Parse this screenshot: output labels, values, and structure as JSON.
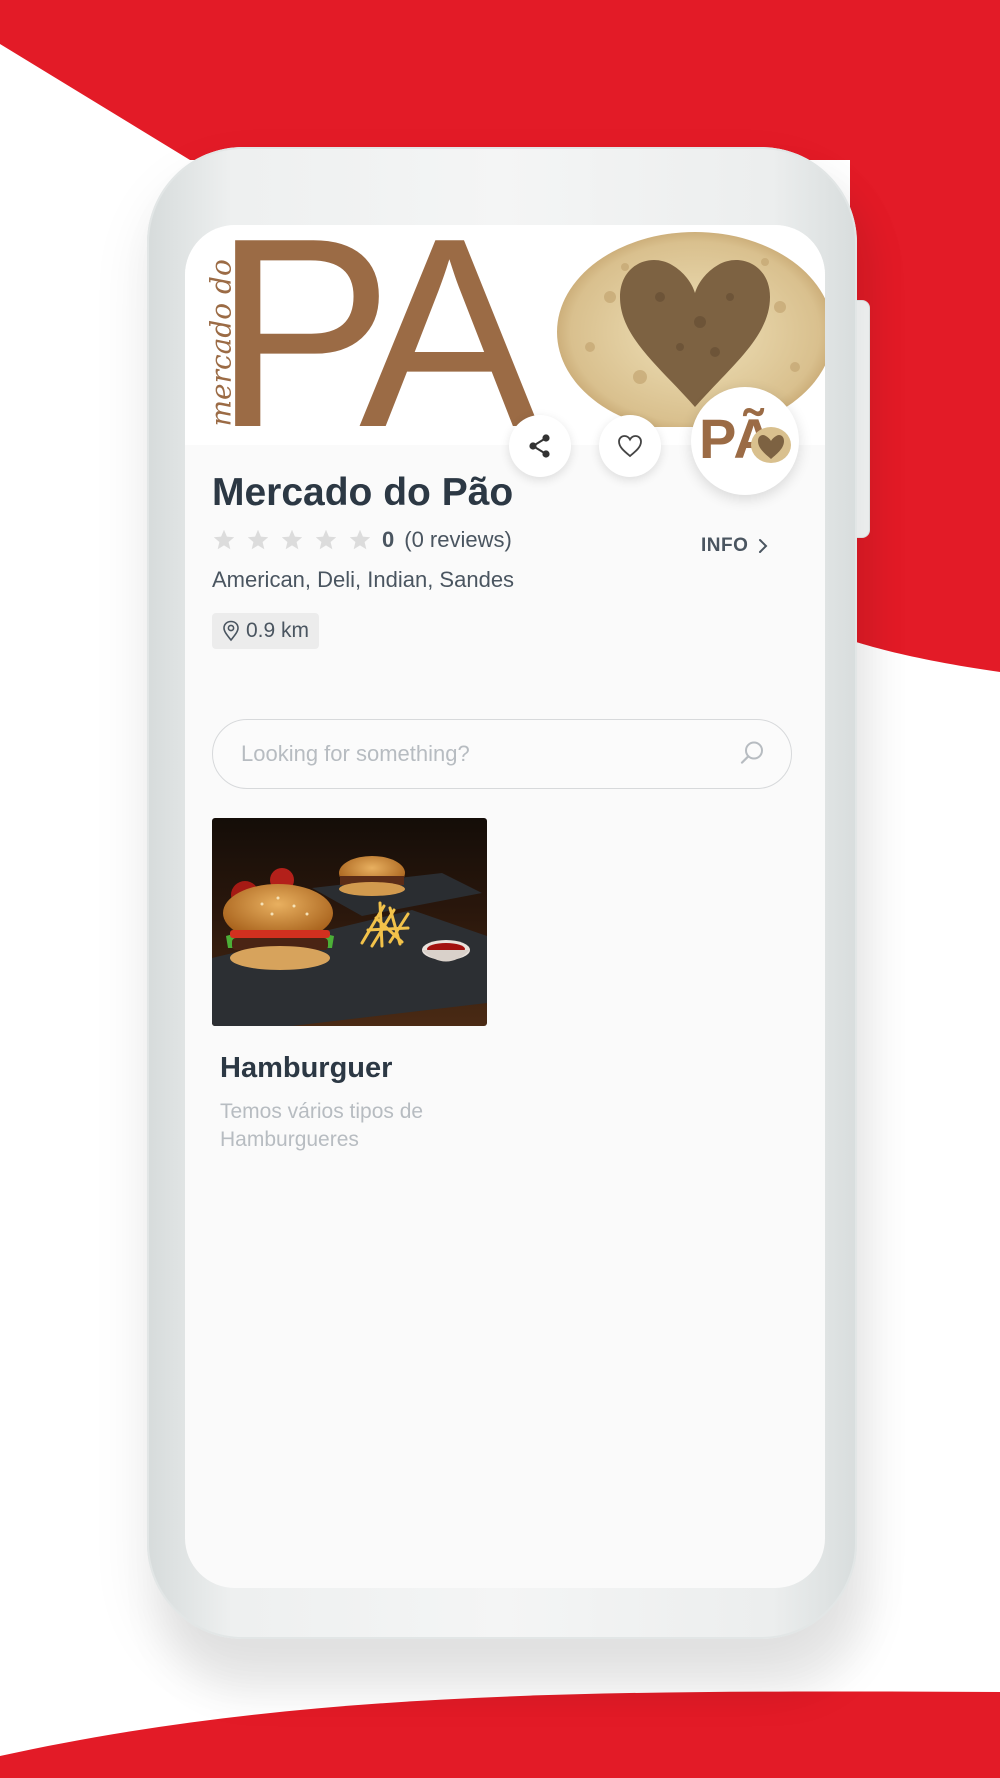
{
  "colors": {
    "brand_red": "#e31b27",
    "text_dark": "#2c3844",
    "text_muted": "#4a5560",
    "text_light": "#b7bcc1",
    "banner_brown": "#9b6b45"
  },
  "header": {
    "banner_text": "PA",
    "banner_script": "mercado do",
    "logo_text": "PÃ",
    "back_icon": "chevron-left-icon",
    "share_icon": "share-icon",
    "favorite_icon": "heart-icon"
  },
  "store": {
    "name": "Mercado do Pão",
    "rating_value": "0",
    "reviews_label": "(0 reviews)",
    "info_label": "INFO",
    "cuisines": "American, Deli, Indian, Sandes",
    "distance": "0.9 km",
    "star_rating": 0,
    "star_count": 5
  },
  "search": {
    "placeholder": "Looking for something?",
    "value": ""
  },
  "categories": [
    {
      "title": "Hamburguer",
      "description": "Temos vários tipos de Hamburgueres"
    }
  ]
}
